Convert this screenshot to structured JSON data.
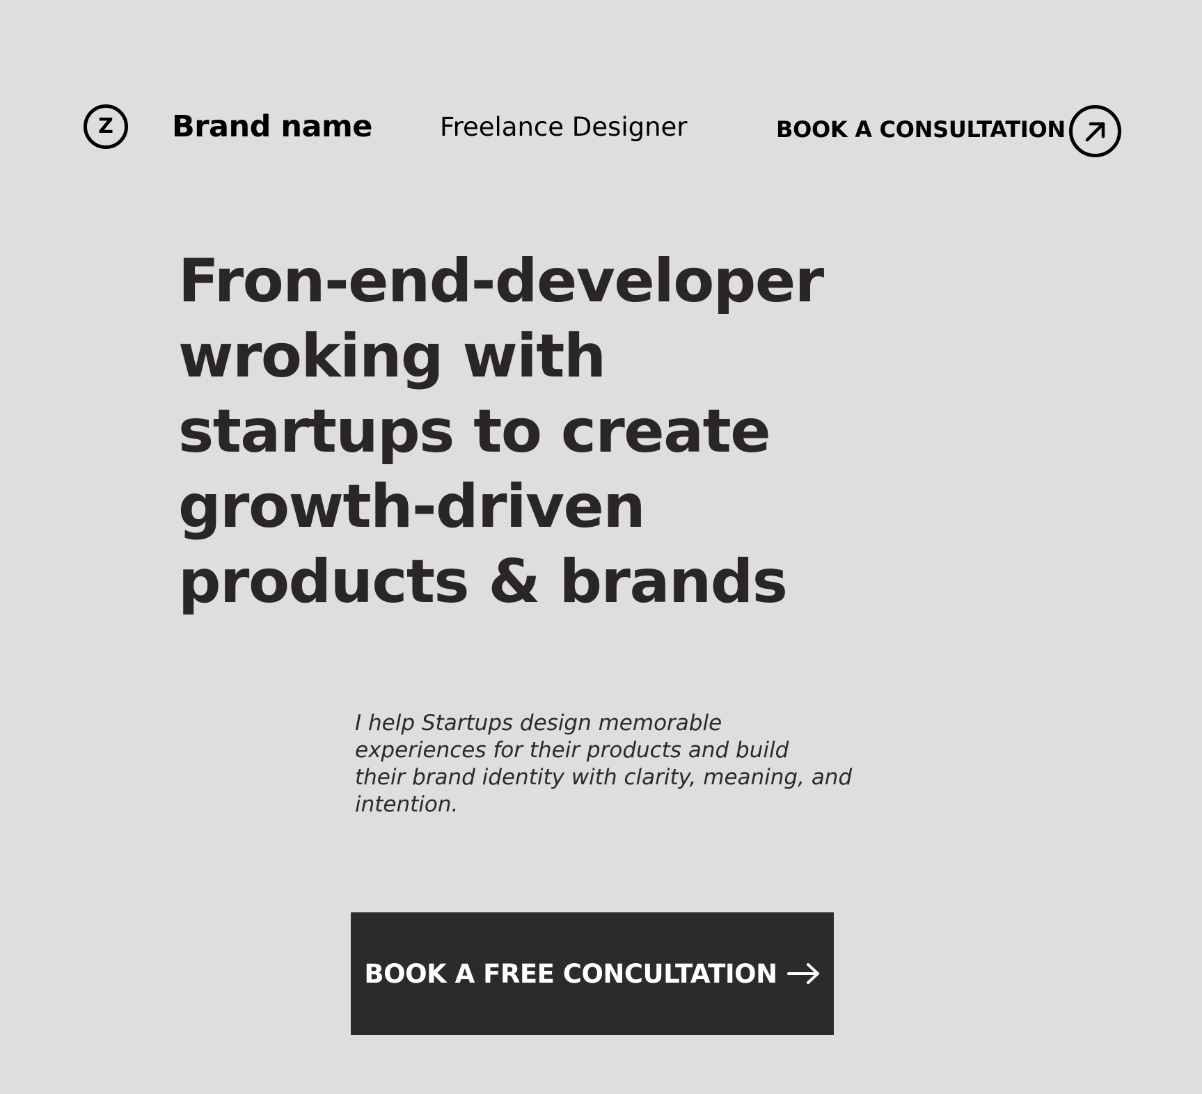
{
  "header": {
    "logo_letter": "Z",
    "brand_name": "Brand name",
    "role": "Freelance Designer",
    "cta_label": "BOOK A CONSULTATION",
    "cta_icon": "arrow-up-right-icon"
  },
  "hero": {
    "headline_lines": [
      "Fron-end-developer",
      "wroking with",
      "startups to create",
      "growth-driven",
      "products & brands"
    ],
    "intro_lines": [
      " I help Startups design memorable",
      "experiences for their products and build",
      "their brand identity with clarity, meaning, and",
      "intention."
    ],
    "cta_label": "BOOK A FREE CONCULTATION",
    "cta_icon": "arrow-right-icon"
  },
  "colors": {
    "background": "#dedede",
    "text": "#000000",
    "headline": "#2a2526",
    "button_bg": "#2a2b2d",
    "button_text": "#ffffff"
  }
}
